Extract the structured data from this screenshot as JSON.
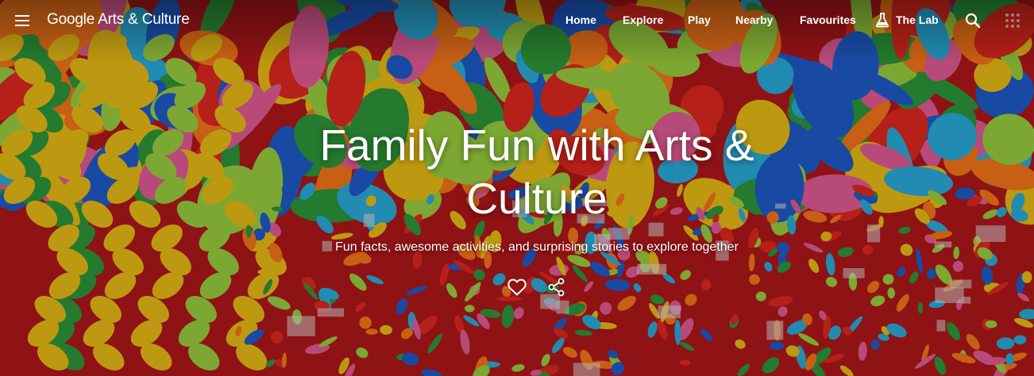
{
  "header": {
    "logo": "Google Arts & Culture",
    "nav": {
      "home": "Home",
      "explore": "Explore",
      "play": "Play",
      "nearby": "Nearby",
      "favourites": "Favourites",
      "lab": "The Lab"
    },
    "icons": {
      "menu": "menu-icon",
      "lab": "flask-icon",
      "search": "search-icon",
      "apps": "apps-grid-icon"
    }
  },
  "hero": {
    "title": "Family Fun with Arts & Culture",
    "subtitle": "Fun facts, awesome activities, and surprising stories to explore together",
    "image": "colorful twisted balloons",
    "actions": {
      "favourite": "heart-icon",
      "share": "share-icon"
    }
  },
  "colors": {
    "text": "#ffffff",
    "overlay": "#000000",
    "balloon_palette": [
      "#e8291f",
      "#f2c417",
      "#2f9d3c",
      "#1f5fd1",
      "#ff7a1a",
      "#ec5f9c",
      "#9fd640",
      "#2bb3e3"
    ]
  }
}
